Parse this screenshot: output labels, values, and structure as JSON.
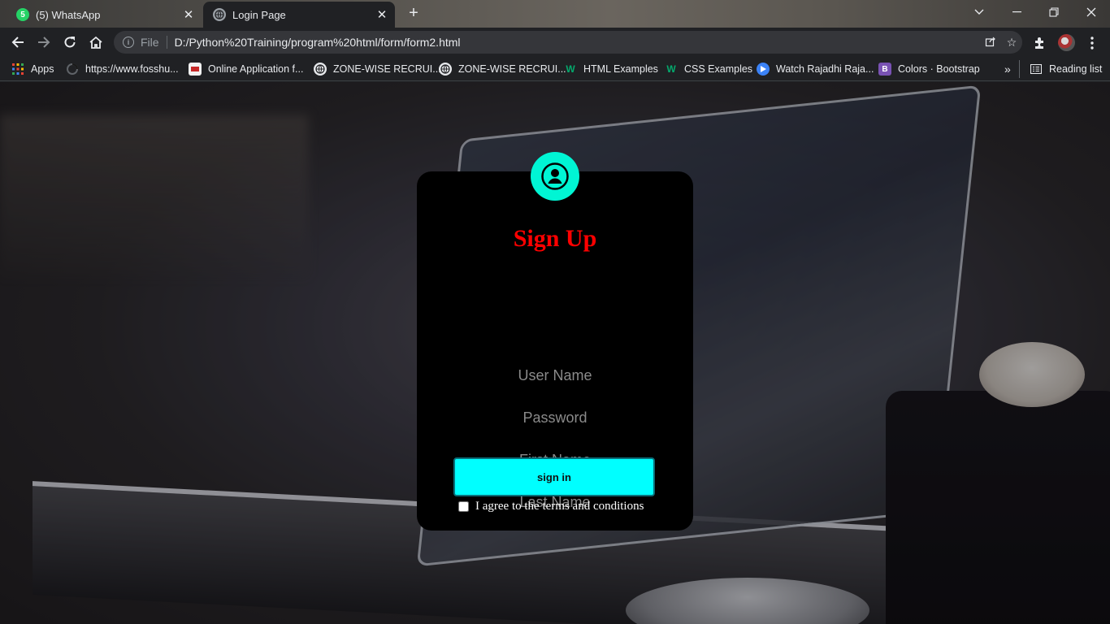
{
  "browser": {
    "tabs": [
      {
        "title": "(5) WhatsApp",
        "badge": "5",
        "active": false
      },
      {
        "title": "Login Page",
        "active": true
      }
    ],
    "address": {
      "scheme_label": "File",
      "url": "D:/Python%20Training/program%20html/form/form2.html"
    },
    "bookmarks": [
      {
        "label": "Apps",
        "icon": "apps-grid-icon"
      },
      {
        "label": "https://www.fosshu...",
        "icon": "loading-ring-icon"
      },
      {
        "label": "Online Application f...",
        "icon": "site-icon"
      },
      {
        "label": "ZONE-WISE RECRUI...",
        "icon": "globe-icon"
      },
      {
        "label": "ZONE-WISE RECRUI...",
        "icon": "globe-icon"
      },
      {
        "label": "HTML Examples",
        "icon": "w3schools-icon"
      },
      {
        "label": "CSS Examples",
        "icon": "w3schools-icon"
      },
      {
        "label": "Watch Rajadhi Raja...",
        "icon": "play-icon"
      },
      {
        "label": "Colors · Bootstrap",
        "icon": "bootstrap-icon"
      }
    ],
    "overflow_label": "»",
    "reading_list_label": "Reading list",
    "colors": {
      "chrome_dark": "#202124",
      "omnibox": "#35363a",
      "whatsapp": "#25d366"
    }
  },
  "form": {
    "title": "Sign Up",
    "fields": [
      {
        "placeholder": "User Name"
      },
      {
        "placeholder": "Password"
      },
      {
        "placeholder": "First Name"
      },
      {
        "placeholder": "Last Name"
      }
    ],
    "submit_label": "sign in",
    "agree_label": "I agree to the terms and conditions",
    "colors": {
      "card": "#000000",
      "title": "#ff0000",
      "accent": "#00ffff",
      "profile": "#00f5d4"
    }
  }
}
